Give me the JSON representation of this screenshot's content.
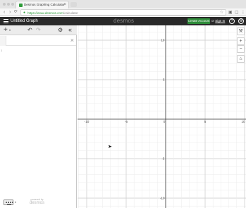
{
  "browser": {
    "tab_title": "Desmos Graphing Calculator",
    "tab_close": "×",
    "url_host": "https://www.desmos.com",
    "url_path": "/calculator",
    "back_icon": "‹",
    "forward_icon": "›",
    "reload_icon": "⟳"
  },
  "header": {
    "graph_title": "Untitled Graph",
    "brand": "desmos",
    "create_account": "Create Account",
    "or": "or",
    "sign_in": "Sign In",
    "help_icon": "?",
    "globe_icon": "⊕"
  },
  "panel": {
    "add_label": "+",
    "add_caret": "▾",
    "undo_icon": "↶",
    "redo_icon": "↷",
    "settings_icon": "⚙",
    "collapse_icon": "«",
    "expression_index": "1",
    "delete_icon": "×",
    "keyboard_caret": "▾",
    "powered_by": "powered by",
    "powered_brand": "desmos"
  },
  "graph": {
    "x_ticks": [
      "-10",
      "-5",
      "0",
      "5",
      "10"
    ],
    "y_ticks": [
      "10",
      "5",
      "-5",
      "-10"
    ],
    "tools": {
      "wrench": "🔧",
      "zoom_in": "+",
      "zoom_out": "−",
      "home": "⌂"
    }
  }
}
